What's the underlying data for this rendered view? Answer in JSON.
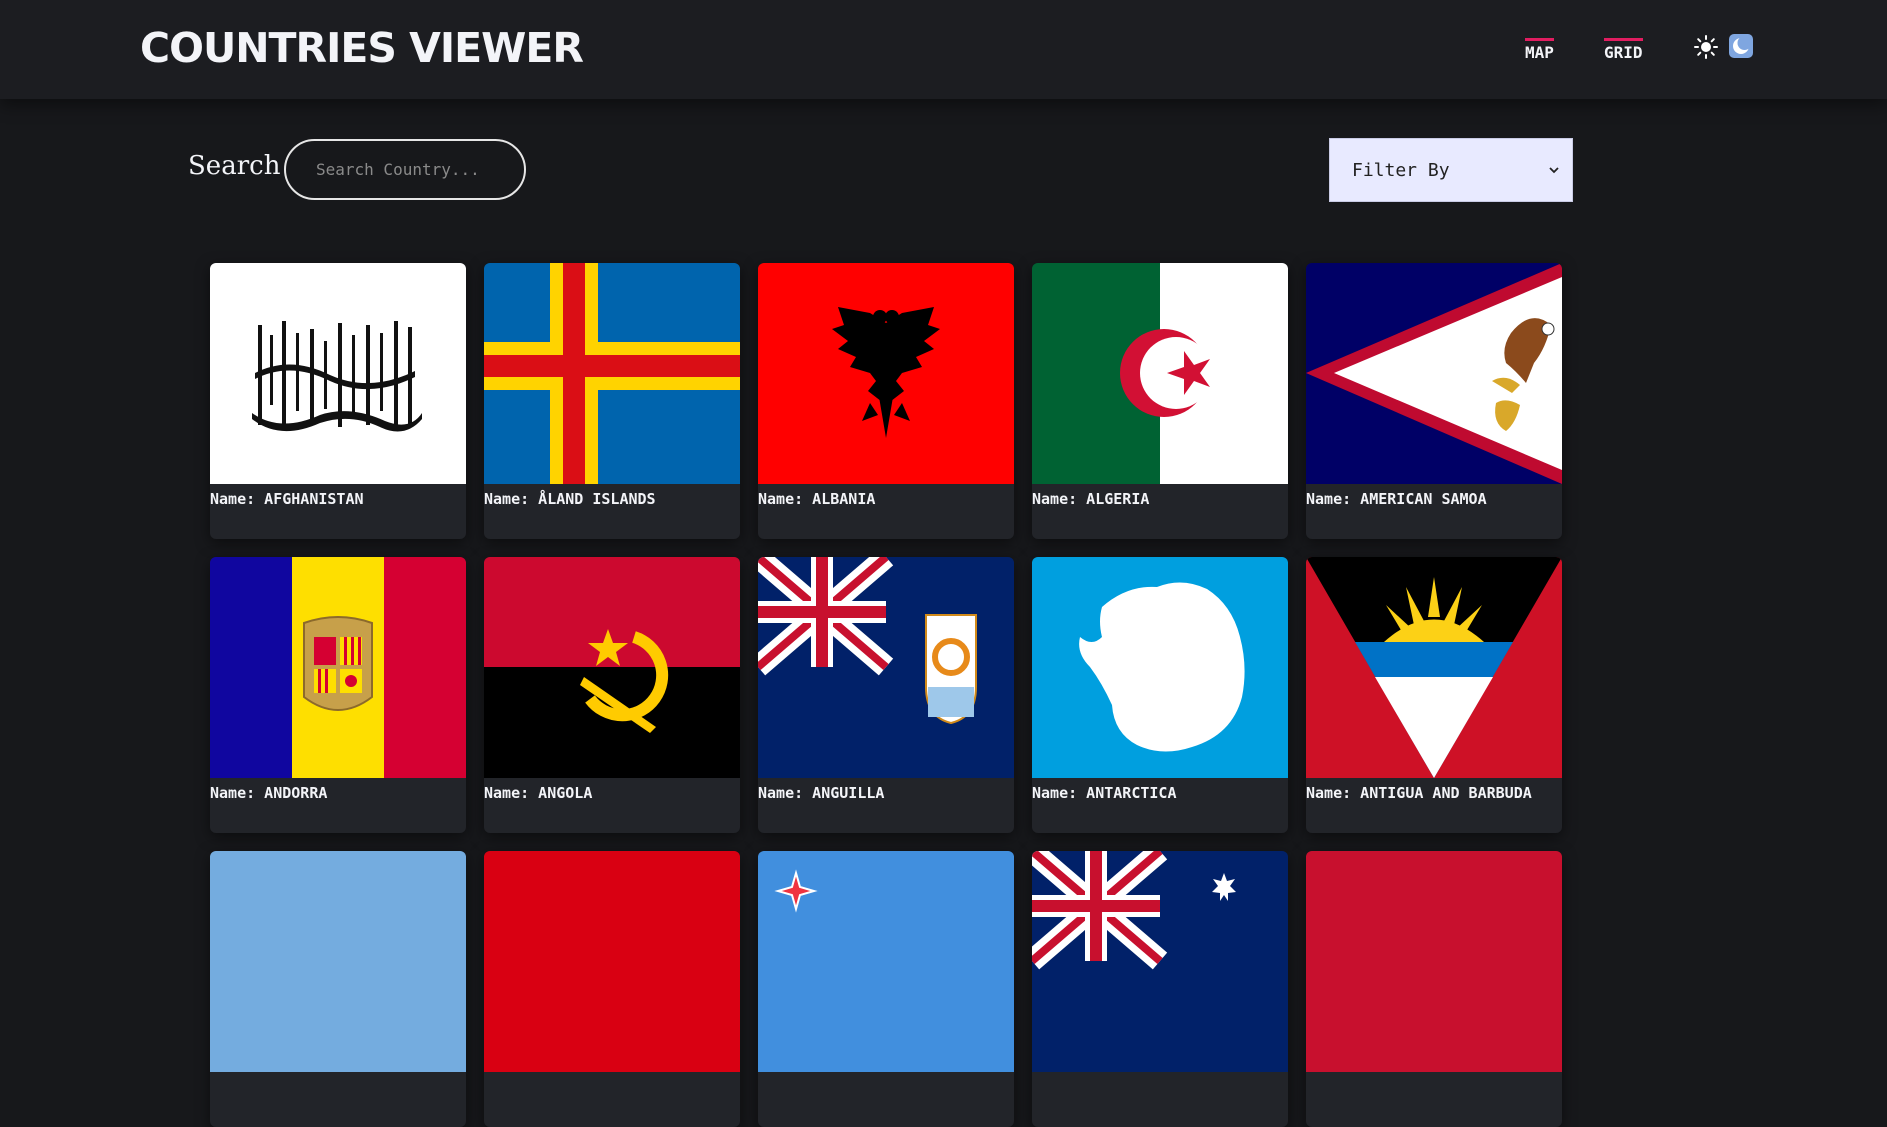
{
  "header": {
    "brand": "COUNTRIES VIEWER",
    "nav": [
      {
        "label": "MAP"
      },
      {
        "label": "GRID"
      }
    ],
    "theme_icons": [
      "sun-icon",
      "moon-icon"
    ],
    "accent": "#e21d61"
  },
  "search": {
    "label": "Search",
    "placeholder": "Search Country..."
  },
  "filter": {
    "selected": "Filter By"
  },
  "name_prefix": "Name: ",
  "countries": [
    {
      "name": "Name: AFGHANISTAN",
      "flag": "afghanistan"
    },
    {
      "name": "Name: ÅLAND ISLANDS",
      "flag": "aland"
    },
    {
      "name": "Name: ALBANIA",
      "flag": "albania"
    },
    {
      "name": "Name: ALGERIA",
      "flag": "algeria"
    },
    {
      "name": "Name: AMERICAN SAMOA",
      "flag": "american-samoa"
    },
    {
      "name": "Name: ANDORRA",
      "flag": "andorra"
    },
    {
      "name": "Name: ANGOLA",
      "flag": "angola"
    },
    {
      "name": "Name: ANGUILLA",
      "flag": "anguilla"
    },
    {
      "name": "Name: ANTARCTICA",
      "flag": "antarctica"
    },
    {
      "name": "Name: ANTIGUA AND BARBUDA",
      "flag": "antigua"
    },
    {
      "name": "",
      "flag": "argentina-partial"
    },
    {
      "name": "",
      "flag": "armenia-partial"
    },
    {
      "name": "",
      "flag": "aruba-partial"
    },
    {
      "name": "",
      "flag": "australia-partial"
    },
    {
      "name": "",
      "flag": "austria-partial"
    }
  ]
}
